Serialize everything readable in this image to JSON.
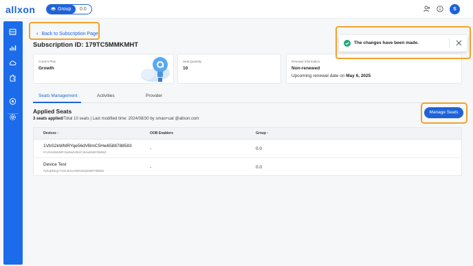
{
  "app": {
    "logo": "allxon",
    "workspace_label": "Group",
    "workspace_version": "0.0",
    "user_initial": "S"
  },
  "icons": {
    "workspace": "layers-icon",
    "add_user": "add-user-icon",
    "info": "info-icon",
    "sidebar": [
      "devices-icon",
      "analytics-icon",
      "cloud-icon",
      "extensions-icon",
      "alerts-icon",
      "settings-icon"
    ]
  },
  "page": {
    "back_label": "Back to Subscription Page",
    "subscription_id": "Subscription ID: 179TC5MMKMHT"
  },
  "cards": {
    "plan_label": "Current Plan",
    "plan_value": "Growth",
    "seat_label": "Seat Quantity",
    "seat_value": "10",
    "renewal_label": "Renewal Information",
    "renewal_status": "Non-renewed",
    "renewal_date_prefix": "Upcoming renewal date on ",
    "renewal_date": "May 6, 2025"
  },
  "tabs": [
    "Seats Management",
    "Activities",
    "Provider"
  ],
  "applied": {
    "title": "Applied Seats",
    "summary_bold": "3 seats applied",
    "summary_rest": "/Total 10 seats | Last modified time: 2024/08/30 by smao+uat @allxon.com",
    "manage_button": "Manage Seats"
  },
  "table": {
    "columns": [
      "Devices",
      "OOB Enablers",
      "Group"
    ],
    "rows": [
      {
        "name": "1VbS2kWMRYqe56dVBmC5Hw6588788583",
        "id": "#1VbS2kWMRYqe56dVBmC5Hw6588788583",
        "oob": "-",
        "group": "0.0"
      },
      {
        "name": "Device Test",
        "id": "#ybqDbKgcTSSLBGuvN9Nx5Q6588788583",
        "oob": "-",
        "group": "0.0"
      }
    ]
  },
  "toast": {
    "message": "The changes have been made."
  },
  "colors": {
    "accent": "#1e63d8",
    "sidebar": "#1c6bea",
    "highlight": "#f0a12b",
    "success": "#1fa67a"
  }
}
